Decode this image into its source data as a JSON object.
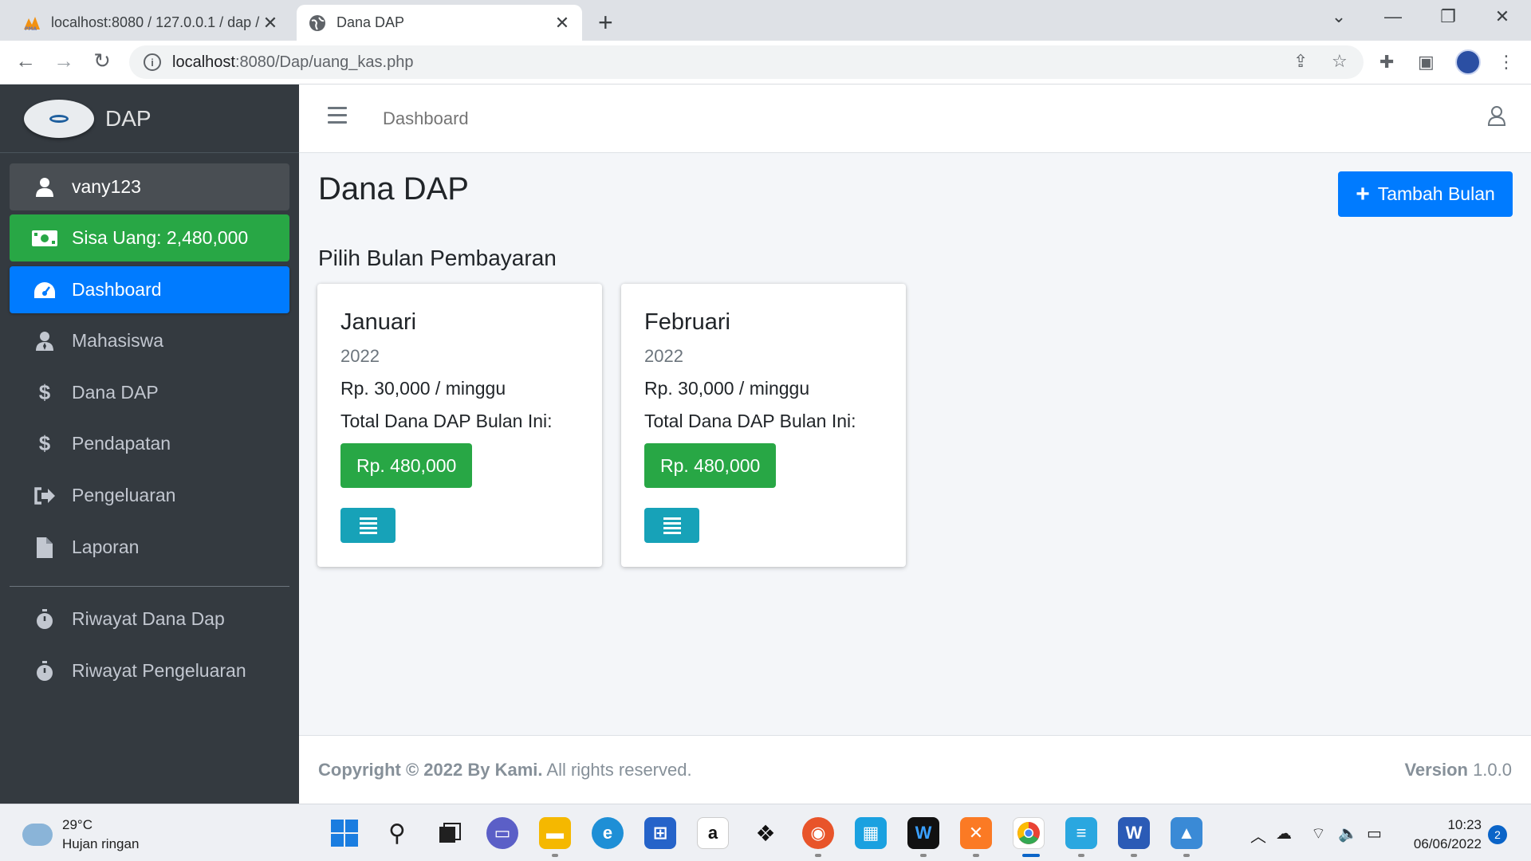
{
  "browser": {
    "tabs": [
      {
        "title": "localhost:8080 / 127.0.0.1 / dap /",
        "active": false
      },
      {
        "title": "Dana DAP",
        "active": true
      }
    ],
    "url_host": "localhost",
    "url_path": ":8080/Dap/uang_kas.php"
  },
  "sidebar": {
    "brand": "DAP",
    "user": "vany123",
    "balance": "Sisa Uang: 2,480,000",
    "items": [
      {
        "label": "Dashboard",
        "icon": "gauge-icon"
      },
      {
        "label": "Mahasiswa",
        "icon": "user-tie-icon"
      },
      {
        "label": "Dana DAP",
        "icon": "dollar-icon"
      },
      {
        "label": "Pendapatan",
        "icon": "dollar-icon"
      },
      {
        "label": "Pengeluaran",
        "icon": "sign-out-icon"
      },
      {
        "label": "Laporan",
        "icon": "file-icon"
      },
      {
        "label": "Riwayat Dana Dap",
        "icon": "stopwatch-icon"
      },
      {
        "label": "Riwayat Pengeluaran",
        "icon": "stopwatch-icon"
      }
    ]
  },
  "topnav": {
    "link": "Dashboard"
  },
  "content": {
    "title": "Dana DAP",
    "add_button": "Tambah Bulan",
    "subtitle": "Pilih Bulan Pembayaran",
    "cards": [
      {
        "month": "Januari",
        "year": "2022",
        "rate": "Rp. 30,000 / minggu",
        "total_label": "Total Dana DAP Bulan Ini:",
        "total": "Rp. 480,000"
      },
      {
        "month": "Februari",
        "year": "2022",
        "rate": "Rp. 30,000 / minggu",
        "total_label": "Total Dana DAP Bulan Ini:",
        "total": "Rp. 480,000"
      }
    ]
  },
  "footer": {
    "copyright_bold": "Copyright © 2022 By Kami.",
    "copyright_rest": " All rights reserved.",
    "version_label": "Version",
    "version_value": " 1.0.0"
  },
  "taskbar": {
    "weather_temp": "29°C",
    "weather_desc": "Hujan ringan",
    "time": "10:23",
    "date": "06/06/2022",
    "notifications": "2"
  },
  "colors": {
    "sidebar_bg": "#343a40",
    "primary": "#007bff",
    "success": "#28a745",
    "info": "#17a2b8"
  }
}
